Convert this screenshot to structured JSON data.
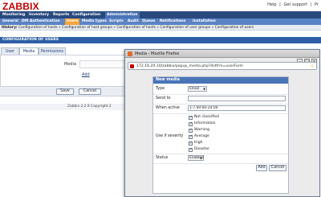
{
  "app": {
    "logo": "ZABBIX"
  },
  "toplinks": [
    "Help",
    "|",
    "Get support",
    "|",
    "Pr"
  ],
  "mainmenu": [
    {
      "label": "Monitoring",
      "active": false
    },
    {
      "label": "Inventory",
      "active": false
    },
    {
      "label": "Reports",
      "active": false
    },
    {
      "label": "Configuration",
      "active": false
    },
    {
      "label": "Administration",
      "active": true
    }
  ],
  "submenu": [
    {
      "label": "General",
      "active": false
    },
    {
      "label": "DM",
      "active": false
    },
    {
      "label": "Authentication",
      "active": false
    },
    {
      "label": "Users",
      "active": true
    },
    {
      "label": "Media types",
      "active": false
    },
    {
      "label": "Scripts",
      "active": false
    },
    {
      "label": "Audit",
      "active": false
    },
    {
      "label": "Queue",
      "active": false
    },
    {
      "label": "Notifications",
      "active": false
    },
    {
      "label": "Installation",
      "active": false
    }
  ],
  "history": {
    "label": "History:",
    "path": "Configuration of hosts » Configuration of host groups » Configuration of hosts » Configuration of user groups » Configuration of users"
  },
  "page": {
    "title": "CONFIGURATION OF USERS"
  },
  "tabs": [
    {
      "label": "User",
      "active": false
    },
    {
      "label": "Media",
      "active": true
    },
    {
      "label": "Permissions",
      "active": false
    }
  ],
  "media_form": {
    "label": "Media",
    "add_link": "Add"
  },
  "buttons": {
    "save": "Save",
    "cancel": "Cancel"
  },
  "footer": {
    "text": "Zabbix 2.2.9 Copyright 2"
  },
  "popup": {
    "window_title": "Media - Mozilla Firefox",
    "url": "172.16.20.10/zabbix/popup_media.php?dstfrm=userForm",
    "panel_title": "New media",
    "type_label": "Type",
    "type_value": "Email",
    "send_to_label": "Send to",
    "send_to_value": "",
    "when_active_label": "When active",
    "when_active_value": "1-7,00:00-24:00",
    "severity_label": "Use if severity",
    "severities": [
      {
        "label": "Not classified",
        "checked": true
      },
      {
        "label": "Information",
        "checked": true
      },
      {
        "label": "Warning",
        "checked": true
      },
      {
        "label": "Average",
        "checked": true
      },
      {
        "label": "High",
        "checked": true
      },
      {
        "label": "Disaster",
        "checked": true
      }
    ],
    "status_label": "Status",
    "status_value": "Enabled",
    "add_button": "Add",
    "cancel_button": "Cancel"
  },
  "icons": {
    "window": "firefox-icon",
    "favicon": "zabbix-favicon",
    "bookmark": "star-icon",
    "extension": "abp-icon"
  },
  "colors": {
    "brand": "#c30000",
    "menu": "#2a4a7e",
    "submenu": "#5c84c4",
    "active_subtab": "#f3a43a",
    "header": "#2e5fa5"
  }
}
